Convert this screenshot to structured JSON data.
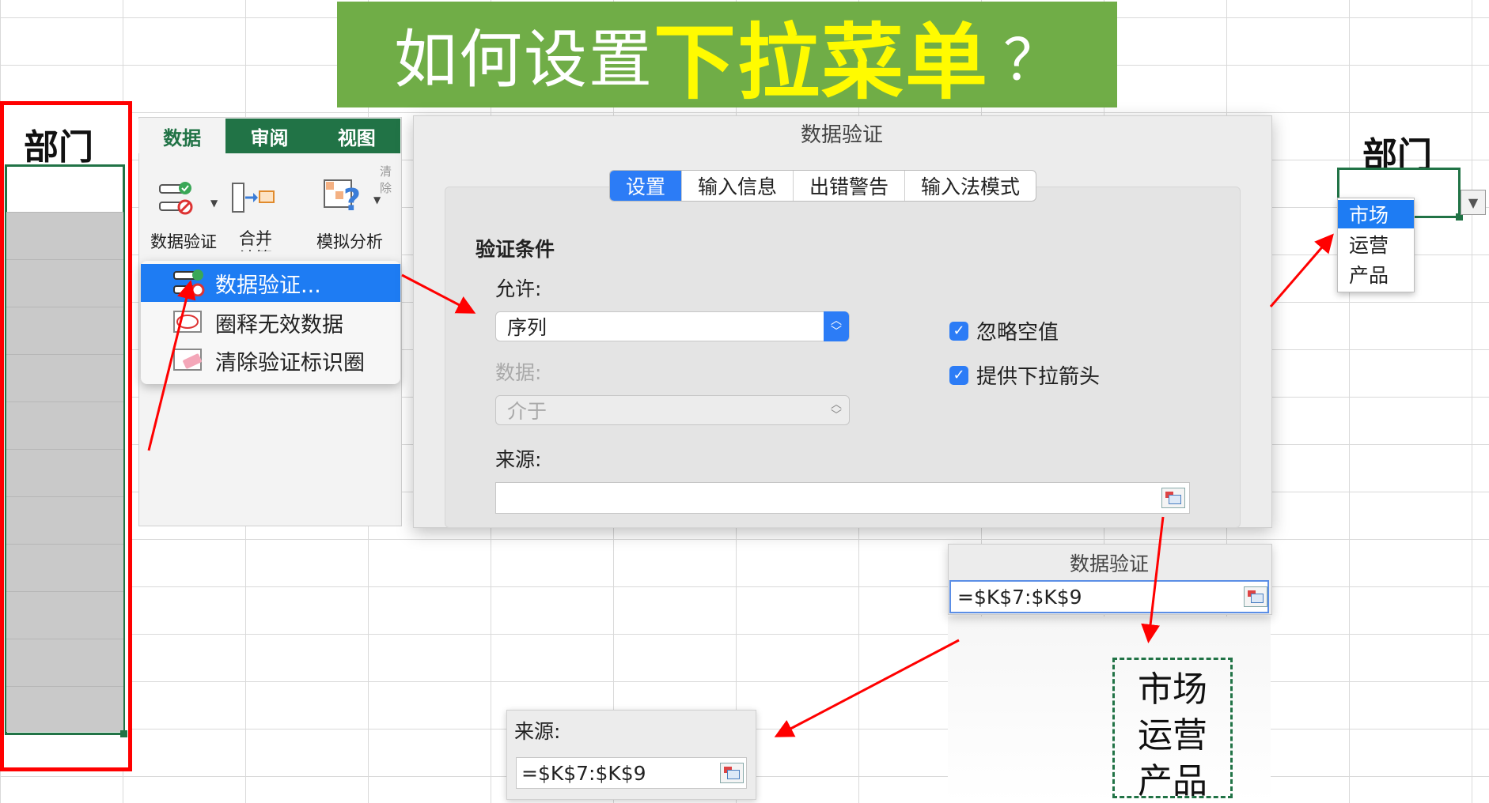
{
  "banner": {
    "part1": "如何设置",
    "part2": "下拉菜单",
    "part3": "？"
  },
  "left_column": {
    "header": "部门"
  },
  "ribbon": {
    "tabs": [
      {
        "label": "数据"
      },
      {
        "label": "审阅"
      },
      {
        "label": "视图"
      }
    ],
    "buttons": {
      "data_validation": "数据验证",
      "consolidate": "合并计算",
      "what_if": "模拟分析",
      "clear_partial": "清除"
    }
  },
  "menu": {
    "items": [
      {
        "label": "数据验证..."
      },
      {
        "label": "圈释无效数据"
      },
      {
        "label": "清除验证标识圈"
      }
    ]
  },
  "dialog": {
    "title": "数据验证",
    "tabs": [
      {
        "label": "设置"
      },
      {
        "label": "输入信息"
      },
      {
        "label": "出错警告"
      },
      {
        "label": "输入法模式"
      }
    ],
    "section": "验证条件",
    "allow_label": "允许:",
    "allow_value": "序列",
    "data_label": "数据:",
    "data_value": "介于",
    "source_label": "来源:",
    "source_value": "",
    "checkbox_ignore_blank": "忽略空值",
    "checkbox_dropdown": "提供下拉箭头"
  },
  "right_cell": {
    "header": "部门",
    "options": [
      {
        "label": "市场"
      },
      {
        "label": "运营"
      },
      {
        "label": "产品"
      }
    ]
  },
  "mini_dialog": {
    "title": "数据验证",
    "value": "=$K$7:$K$9"
  },
  "source_list": {
    "items": [
      {
        "label": "市场"
      },
      {
        "label": "运营"
      },
      {
        "label": "产品"
      }
    ]
  },
  "source_panel": {
    "label": "来源:",
    "value": "=$K$7:$K$9"
  },
  "colors": {
    "accent": "#217346",
    "banner": "#70ad47",
    "banner_highlight": "#fffb00",
    "select_blue": "#1e7cf3",
    "arrow_red": "#ff0000"
  }
}
